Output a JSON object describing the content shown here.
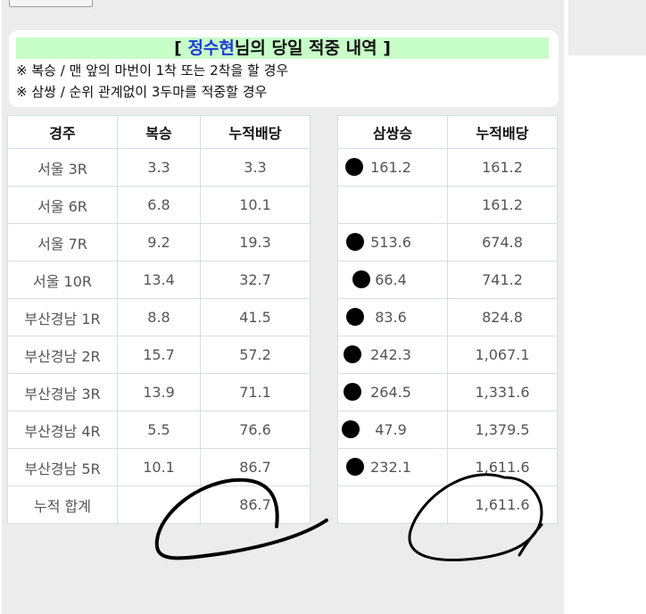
{
  "header": {
    "title_open": "[ ",
    "title_name": "정수현",
    "title_rest": "님의 당일 적중 내역 ]",
    "notes": [
      "※ 복승 / 맨 앞의 마번이 1착 또는 2착을 할 경우",
      "※ 삼쌍 / 순위 관계없이 3두마를 적중할 경우"
    ]
  },
  "left_table": {
    "headers": [
      "경주",
      "복승",
      "누적배당"
    ],
    "rows": [
      {
        "race": "서울 3R",
        "bokseung": "3.3",
        "cumulative": "3.3"
      },
      {
        "race": "서울 6R",
        "bokseung": "6.8",
        "cumulative": "10.1"
      },
      {
        "race": "서울 7R",
        "bokseung": "9.2",
        "cumulative": "19.3"
      },
      {
        "race": "서울 10R",
        "bokseung": "13.4",
        "cumulative": "32.7"
      },
      {
        "race": "부산경남 1R",
        "bokseung": "8.8",
        "cumulative": "41.5"
      },
      {
        "race": "부산경남 2R",
        "bokseung": "15.7",
        "cumulative": "57.2"
      },
      {
        "race": "부산경남 3R",
        "bokseung": "13.9",
        "cumulative": "71.1"
      },
      {
        "race": "부산경남 4R",
        "bokseung": "5.5",
        "cumulative": "76.6"
      },
      {
        "race": "부산경남 5R",
        "bokseung": "10.1",
        "cumulative": "86.7"
      }
    ],
    "total_label": "누적 합계",
    "total_value": "86.7"
  },
  "right_table": {
    "headers": [
      "삼쌍승",
      "누적배당"
    ],
    "rows": [
      {
        "samssang": "161.2",
        "cumulative": "161.2",
        "dot": true
      },
      {
        "samssang": "",
        "cumulative": "161.2",
        "dot": false
      },
      {
        "samssang": "513.6",
        "cumulative": "674.8",
        "dot": true
      },
      {
        "samssang": "66.4",
        "cumulative": "741.2",
        "dot": true
      },
      {
        "samssang": "83.6",
        "cumulative": "824.8",
        "dot": true
      },
      {
        "samssang": "242.3",
        "cumulative": "1,067.1",
        "dot": true
      },
      {
        "samssang": "264.5",
        "cumulative": "1,331.6",
        "dot": true
      },
      {
        "samssang": "47.9",
        "cumulative": "1,379.5",
        "dot": true
      },
      {
        "samssang": "232.1",
        "cumulative": "1,611.6",
        "dot": true
      }
    ],
    "total_value": "1,611.6"
  },
  "colors": {
    "title_highlight": "#c8fec8",
    "name_color": "#1f3bd6",
    "total_color": "#1a1ad6",
    "panel_bg": "#ececec"
  }
}
